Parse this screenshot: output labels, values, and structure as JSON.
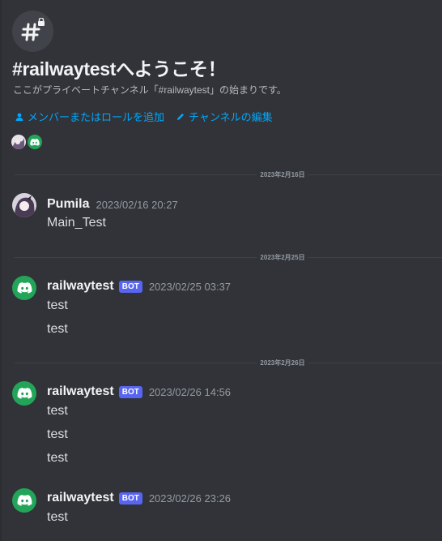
{
  "welcome": {
    "title": "#railwaytestへようこそ！",
    "subtitle": "ここがプライベートチャンネル「#railwaytest」の始まりです。",
    "add_members_label": "メンバーまたはロールを追加",
    "edit_channel_label": "チャンネルの編集"
  },
  "dividers": [
    "2023年2月16日",
    "2023年2月25日",
    "2023年2月26日"
  ],
  "messages": [
    {
      "author": "Pumila",
      "timestamp": "2023/02/16 20:27",
      "lines": [
        "Main_Test"
      ]
    },
    {
      "author": "railwaytest",
      "bot_tag": "BOT",
      "timestamp": "2023/02/25 03:37",
      "lines": [
        "test",
        "test"
      ]
    },
    {
      "author": "railwaytest",
      "bot_tag": "BOT",
      "timestamp": "2023/02/26 14:56",
      "lines": [
        "test",
        "test",
        "test"
      ]
    },
    {
      "author": "railwaytest",
      "bot_tag": "BOT",
      "timestamp": "2023/02/26 23:26",
      "lines": [
        "test"
      ]
    }
  ],
  "colors": {
    "background": "#313338",
    "bot_tag": "#5865f2",
    "link": "#00a8fc",
    "discord_avatar": "#23a559"
  },
  "icons": [
    "hashtag-lock-icon",
    "person-add-icon",
    "pencil-icon",
    "discord-logo-icon"
  ]
}
